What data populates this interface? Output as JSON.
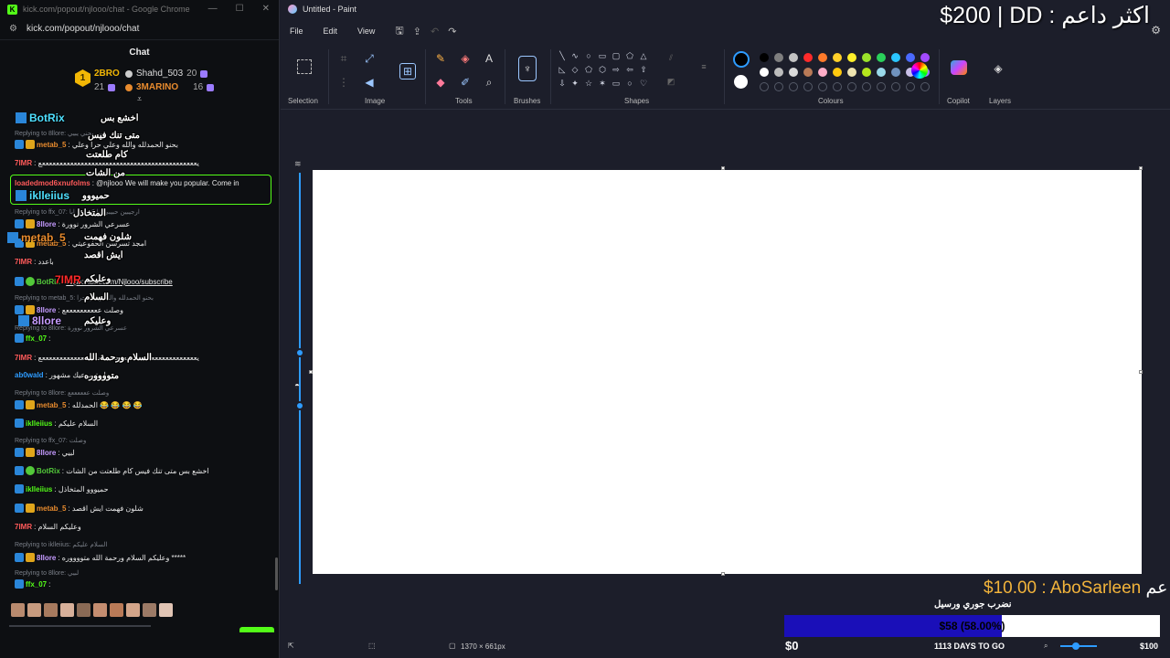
{
  "chrome": {
    "title": "kick.com/popout/njlooo/chat - Google Chrome",
    "url": "kick.com/popout/njlooo/chat",
    "min": "—",
    "max": "☐",
    "close": "✕"
  },
  "chat": {
    "header": "Chat",
    "leaders": {
      "rank": "1",
      "first_name": "2BRO",
      "first_count": "21",
      "second_name": "Shahd_503",
      "second_count": "20",
      "third_name": "3MARINO",
      "third_count": "16"
    },
    "messages": [
      {
        "type": "reply",
        "text": "Replying to 8llore: يبيي بجني يبيي"
      },
      {
        "type": "msg",
        "user": "metab_5",
        "color": "#e88b2e",
        "badges": [
          "mod",
          "vip"
        ],
        "text": "بحنو الحمدلله والله وعلي حرا وعلي"
      },
      {
        "type": "msg",
        "user": "7IMR",
        "color": "#ff5a5a",
        "badges": [],
        "text": "يععععععععععععععععععععععععععععععععععععععععععععع"
      },
      {
        "type": "msg",
        "user": "loadedmod6xnufolms",
        "color": "#ff5a5a",
        "badges": [],
        "text": "@njlooo We will make you popular. Come in"
      },
      {
        "type": "reply",
        "text": "Replying to ffx_07: ارجيبين حبيبي وانكمسبع ابا"
      },
      {
        "type": "msg",
        "user": "8llore",
        "color": "#c59bff",
        "badges": [
          "mod",
          "vip"
        ],
        "text": "عسرعي الشرور نوورة"
      },
      {
        "type": "msg",
        "user": "metab_5",
        "color": "#e88b2e",
        "badges": [
          "mod",
          "vip"
        ],
        "text": "امجد تسرسن الحفوعيتي"
      },
      {
        "type": "msg",
        "user": "7IMR",
        "color": "#ff5a5a",
        "badges": [],
        "text": "باعدد"
      },
      {
        "type": "msg",
        "user": "BotRix",
        "color": "#53c93a",
        "badges": [
          "mod",
          "bot"
        ],
        "text": "https://kick.com/Njlooo/subscribe"
      },
      {
        "type": "reply",
        "text": "Replying to metab_5: بحنو الحمدلله والله وعلي حرا"
      },
      {
        "type": "msg",
        "user": "8llore",
        "color": "#c59bff",
        "badges": [
          "mod",
          "vip"
        ],
        "text": "وصلت ععععععععععع"
      },
      {
        "type": "reply",
        "text": "Replying to 8llore: عسرعي الشرور نوورة"
      },
      {
        "type": "msg",
        "user": "ffx_07",
        "color": "#53fc18",
        "badges": [
          "mod"
        ],
        "text": ""
      },
      {
        "type": "msg",
        "user": "7IMR",
        "color": "#ff5a5a",
        "badges": [],
        "text": "يععععععععععععععععععععععععععععععععععععععععععععع"
      },
      {
        "type": "msg",
        "user": "ab0wald",
        "color": "#2e9cff",
        "badges": [],
        "text": "نجلو تسرعيك مشهور"
      },
      {
        "type": "reply",
        "text": "Replying to 8llore: وصلت ععععععع"
      },
      {
        "type": "msg",
        "user": "metab_5",
        "color": "#e88b2e",
        "badges": [
          "mod",
          "vip"
        ],
        "text": "الحمدلله 😂 😂 😂 😂"
      },
      {
        "type": "msg",
        "user": "iklleiius",
        "color": "#53fc18",
        "badges": [
          "mod"
        ],
        "text": "السلام عليكم"
      },
      {
        "type": "reply",
        "text": "Replying to ffx_07: وصلت"
      },
      {
        "type": "msg",
        "user": "8llore",
        "color": "#c59bff",
        "badges": [
          "mod",
          "vip"
        ],
        "text": "لبيي"
      },
      {
        "type": "msg",
        "user": "BotRix",
        "color": "#53c93a",
        "badges": [
          "mod",
          "bot"
        ],
        "text": "اخشع بس متى تنك فيس كام طلعتت من الشات"
      },
      {
        "type": "msg",
        "user": "iklleiius",
        "color": "#53fc18",
        "badges": [
          "mod"
        ],
        "text": "حميووو المتخاذل"
      },
      {
        "type": "msg",
        "user": "metab_5",
        "color": "#e88b2e",
        "badges": [
          "mod",
          "vip"
        ],
        "text": "شلون فهمت ايش اقصد"
      },
      {
        "type": "msg",
        "user": "7IMR",
        "color": "#ff5a5a",
        "badges": [],
        "text": "وعليكم السلام"
      },
      {
        "type": "reply",
        "text": "Replying to iklleiius: السلام عليكم"
      },
      {
        "type": "msg",
        "user": "8llore",
        "color": "#c59bff",
        "badges": [
          "mod",
          "vip"
        ],
        "text": "وعليكم السلام ورحمة الله متووووره *****"
      },
      {
        "type": "reply",
        "text": "Replying to 8llore: لبيي"
      },
      {
        "type": "msg",
        "user": "ffx_07",
        "color": "#53fc18",
        "badges": [
          "mod"
        ],
        "text": ""
      }
    ],
    "overlay": {
      "name1": "BotRix",
      "text1": "اخشع بس",
      "text2": "متى تنك فيس",
      "text3": "كام طلعتت",
      "text4": "من الشات",
      "name2": "iklleiius",
      "text5": "حميووو",
      "text6": "المتخاذل",
      "name3": "metab_5",
      "text7": "شلون فهمت",
      "text8": "ايش اقصد",
      "name4": "7IMR",
      "text9": "وعليكم",
      "text10": "السلام",
      "name5": "8llore",
      "text11": "وعليكم",
      "text12": "السلام ورحمة الله",
      "text13": "متووووره"
    }
  },
  "paint": {
    "title": "Untitled - Paint",
    "menu": {
      "file": "File",
      "edit": "Edit",
      "view": "View"
    },
    "groups": {
      "selection": "Selection",
      "image": "Image",
      "tools": "Tools",
      "brushes": "Brushes",
      "shapes": "Shapes",
      "colours": "Colours",
      "copilot": "Copilot",
      "layers": "Layers"
    },
    "palette_row1": [
      "#000000",
      "#7f7f7f",
      "#c3c3c3",
      "#ff2a2a",
      "#ff7a2a",
      "#ffd02a",
      "#ffef2a",
      "#9be22a",
      "#2ad05a",
      "#2ac5ff",
      "#4a6aff",
      "#a24aff"
    ],
    "palette_row2": [
      "#ffffff",
      "#bdbdbd",
      "#dadada",
      "#b97a57",
      "#ffaec9",
      "#ffc90e",
      "#efe4b0",
      "#b5e61d",
      "#99d9ea",
      "#7092be",
      "#c8bfe7",
      "#9b7bff"
    ],
    "status": {
      "canvas_size": "1370 × 661px"
    }
  },
  "overlays": {
    "top_text": "$200 | DD : اكثر داعم",
    "donation_name": "$10.00 : AboSarleen",
    "donation_cut": "عم",
    "goal_title": "نضرب جوري ورسيل",
    "goal_label": "$58 (58.00%)",
    "goal_fraction": 0.58,
    "goal_min": "$0",
    "goal_days": "1113 DAYS TO GO",
    "goal_max": "$100"
  }
}
